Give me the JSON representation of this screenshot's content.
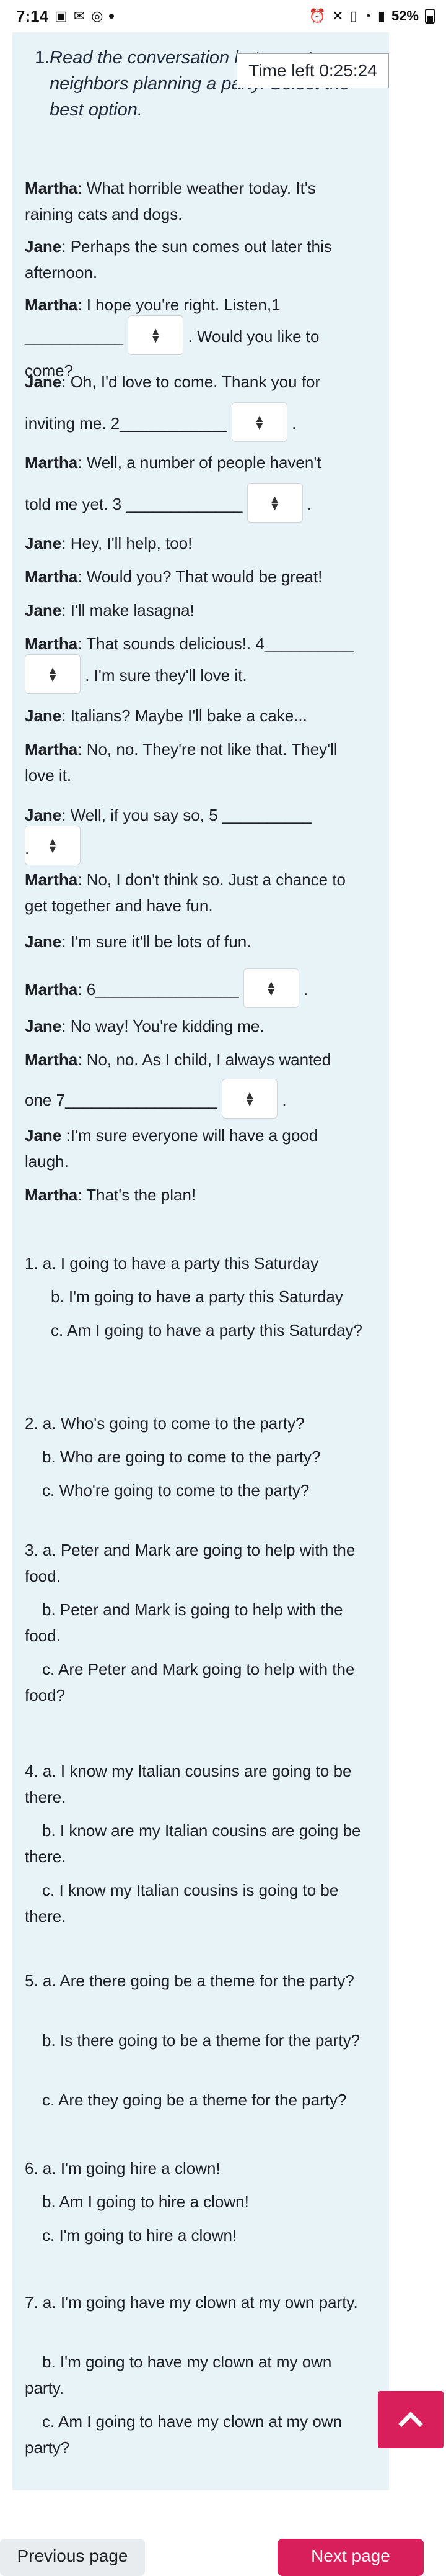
{
  "status_bar": {
    "time": "7:14",
    "battery": "52%"
  },
  "question": {
    "number": "1.",
    "prompt": "Read the conversation between two neighbors planning a party. Select the best option."
  },
  "timer": {
    "label": "Time left 0:25:24"
  },
  "dialogue": {
    "l1_name": "Martha",
    "l1_text": ": What horrible weather today. It's raining cats and dogs.",
    "l2_name": "Jane",
    "l2_text": ": Perhaps the sun comes out later this afternoon.",
    "l3_name": "Martha",
    "l3_text": ": I hope you're right.   Listen,1",
    "l3b_blank": "___________",
    "l3b_text": ". Would you like to come?",
    "l4_name": "Jane",
    "l4_text": ": Oh, I'd love to come. Thank you for",
    "l4b_text": "inviting me. 2____________",
    "l4b_end": ".",
    "l5_name": "Martha",
    "l5_text": ": Well, a number of people haven't",
    "l5b_text": "told me yet. 3 _____________",
    "l5b_end": ".",
    "l6_name": "Jane",
    "l6_text": ": Hey, I'll help, too!",
    "l7_name": "Martha",
    "l7_text": ": Would you? That would be great!",
    "l8_name": "Jane",
    "l8_text": ": I'll make lasagna!",
    "l9_name": "Martha",
    "l9_text": ": That sounds delicious!. 4__________",
    "l9b_text": ". I'm sure they'll love it.",
    "l10_name": "Jane",
    "l10_text": ": Italians? Maybe I'll bake a cake...",
    "l11_name": "Martha",
    "l11_text": ": No, no. They're not like that. They'll love it.",
    "l12_name": "Jane",
    "l12_text": ": Well, if you say so, 5 __________",
    "l12b_text": ".",
    "l13_name": "Martha",
    "l13_text": ": No, I don't think so. Just a chance to get together and have fun.",
    "l14_name": "Jane",
    "l14_text": ": I'm sure it'll be lots of fun.",
    "l15_name": "Martha",
    "l15_text": ": 6________________",
    "l15_end": ".",
    "l16_name": "Jane",
    "l16_text": ": No way! You're kidding me.",
    "l17_name": "Martha",
    "l17_text": ": No, no. As I child, I always wanted",
    "l17b_text": "one 7_________________",
    "l17b_end": ".",
    "l18_name": "Jane",
    "l18_text": " :I'm sure everyone will have a good laugh.",
    "l19_name": "Martha",
    "l19_text": ": That's the plan!"
  },
  "options": {
    "o1a": "1.    a. I going to have a party this Saturday",
    "o1b": "b. I'm going to have a party this Saturday",
    "o1c": "c. Am I going to have a party this Saturday?",
    "o2a": "2. a. Who's going to come to the party?",
    "o2b": "b. Who are going to come to the party?",
    "o2c": "c. Who're going to come to the party?",
    "o3a": "3. a. Peter and Mark are going to help with the food.",
    "o3b": "b. Peter and Mark is going to help with the food.",
    "o3c": "c. Are Peter and Mark going to help with the food?",
    "o4a": "4. a. I know my Italian cousins are going to be there.",
    "o4b": "b. I know are my Italian cousins are going be there.",
    "o4c": "c. I know my Italian cousins is going to be there.",
    "o5a": "5. a. Are there going be a theme for the party?",
    "o5b": "b. Is there going to be a theme for the party?",
    "o5c": "c. Are they going be a theme for the party?",
    "o6a": "6. a. I'm going hire a clown!",
    "o6b": "b. Am I going to hire a clown!",
    "o6c": "c. I'm going to hire a clown!",
    "o7a": "7. a. I'm going have my clown at my own party.",
    "o7b": "b. I'm going to have my clown at my own party.",
    "o7c": "c. Am I going to have my clown at my own party?"
  },
  "nav": {
    "prev_label": "Previous page",
    "next_label": "Next page"
  },
  "icons": {
    "dropdown": "updown-arrows-icon",
    "scroll_top": "chevron-up-icon"
  },
  "colors": {
    "accent": "#d81e5b",
    "panel_bg": "#e8f3f7"
  }
}
